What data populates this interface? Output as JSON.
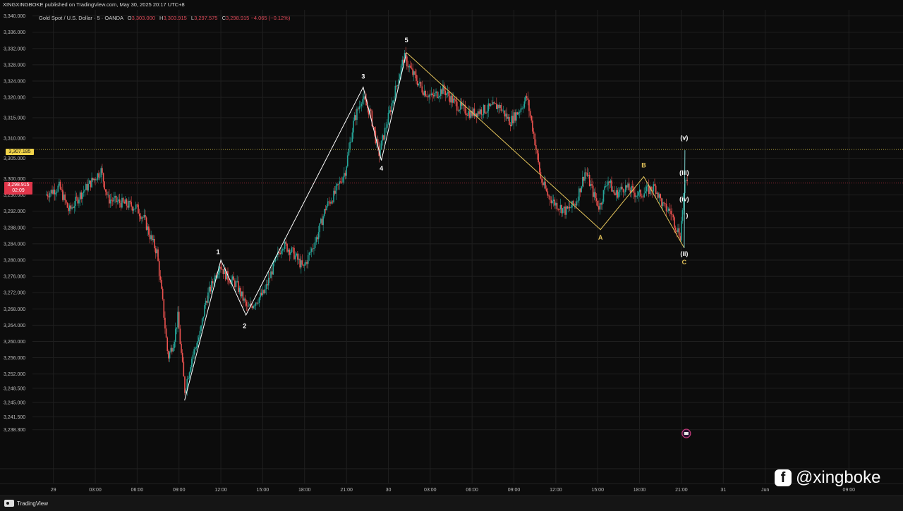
{
  "header": {
    "published_line": "XINGXINGBOKE published on TradingView.com, May 30, 2025 20:17 UTC+8",
    "symbol": "Gold Spot / U.S. Dollar · 5 · OANDA",
    "ohlc": {
      "o_label": "O",
      "o": "3,303.000",
      "h_label": "H",
      "h": "3,303.915",
      "l_label": "L",
      "l": "3,297.575",
      "c_label": "C",
      "c": "3,298.915",
      "change": "−4.065 (−0.12%)"
    }
  },
  "price_tags": {
    "horizontal_line": "3,307.185",
    "current_price": "3,298.915",
    "countdown": "02:09"
  },
  "footer": {
    "brand": "TradingView",
    "watermark": "@xingboke"
  },
  "colors": {
    "background": "#0c0c0c",
    "grid": "#1f1f1f",
    "candle_up": "#26a69a",
    "candle_down": "#ef5350",
    "impulse_line": "#ffffff",
    "correction_line": "#e2c25a",
    "horizontal_line": "#d4c24a",
    "current_price": "#e0364a"
  },
  "chart_data": {
    "type": "candlestick",
    "ylim": [
      3236.0,
      3341.5
    ],
    "y_ticks": [
      "3,340.000",
      "3,336.000",
      "3,332.000",
      "3,328.000",
      "3,324.000",
      "3,320.000",
      "3,315.000",
      "3,310.000",
      "3,305.000",
      "3,300.000",
      "3,296.000",
      "3,292.000",
      "3,288.000",
      "3,284.000",
      "3,280.000",
      "3,276.000",
      "3,272.000",
      "3,268.000",
      "3,264.000",
      "3,260.000",
      "3,256.000",
      "3,252.000",
      "3,248.500",
      "3,245.000",
      "3,241.500",
      "3,238.300"
    ],
    "y_tick_values": [
      3340,
      3336,
      3332,
      3328,
      3324,
      3320,
      3315,
      3310,
      3305,
      3300,
      3296,
      3292,
      3288,
      3284,
      3280,
      3276,
      3272,
      3268,
      3264,
      3260,
      3256,
      3252,
      3248.5,
      3245,
      3241.5,
      3238.3
    ],
    "x_ticks": [
      "29",
      "03:00",
      "06:00",
      "09:00",
      "12:00",
      "15:00",
      "18:00",
      "21:00",
      "30",
      "03:00",
      "06:00",
      "09:00",
      "12:00",
      "15:00",
      "18:00",
      "21:00",
      "31",
      "Jun",
      "09:00"
    ],
    "x_tick_hours": [
      0,
      3,
      6,
      9,
      12,
      15,
      18,
      21,
      24,
      27,
      30,
      33,
      36,
      39,
      42,
      45,
      48,
      51,
      57
    ],
    "x_range_hours": [
      -1.5,
      58.5
    ],
    "price_path": [
      [
        -0.5,
        3296
      ],
      [
        0.5,
        3298
      ],
      [
        1.2,
        3292
      ],
      [
        2,
        3296
      ],
      [
        3,
        3300
      ],
      [
        3.5,
        3302
      ],
      [
        4,
        3295
      ],
      [
        5,
        3294
      ],
      [
        6,
        3293
      ],
      [
        6.6,
        3290
      ],
      [
        7,
        3286
      ],
      [
        7.5,
        3282
      ],
      [
        7.9,
        3270
      ],
      [
        8.3,
        3256
      ],
      [
        8.7,
        3260
      ],
      [
        9,
        3266
      ],
      [
        9.3,
        3255
      ],
      [
        9.5,
        3248
      ],
      [
        10,
        3256
      ],
      [
        10.6,
        3262
      ],
      [
        11,
        3270
      ],
      [
        12,
        3279
      ],
      [
        12.5,
        3276
      ],
      [
        13.2,
        3274
      ],
      [
        14,
        3268
      ],
      [
        14.6,
        3270
      ],
      [
        15.2,
        3272
      ],
      [
        15.8,
        3278
      ],
      [
        16.5,
        3284
      ],
      [
        17.2,
        3282
      ],
      [
        18,
        3278
      ],
      [
        18.5,
        3282
      ],
      [
        19,
        3286
      ],
      [
        19.6,
        3293
      ],
      [
        20.2,
        3296
      ],
      [
        21,
        3302
      ],
      [
        21.6,
        3314
      ],
      [
        22.2,
        3320
      ],
      [
        22.8,
        3316
      ],
      [
        23.4,
        3306
      ],
      [
        24,
        3314
      ],
      [
        24.6,
        3322
      ],
      [
        25.2,
        3330
      ],
      [
        25.8,
        3326
      ],
      [
        26.5,
        3322
      ],
      [
        27.2,
        3320
      ],
      [
        28,
        3322
      ],
      [
        29,
        3318
      ],
      [
        30,
        3316
      ],
      [
        31,
        3317
      ],
      [
        32,
        3318
      ],
      [
        32.8,
        3314
      ],
      [
        33.5,
        3317
      ],
      [
        34,
        3320
      ],
      [
        34.5,
        3311
      ],
      [
        35,
        3300
      ],
      [
        35.5,
        3296
      ],
      [
        36,
        3294
      ],
      [
        36.8,
        3292
      ],
      [
        37.5,
        3294
      ],
      [
        38.2,
        3302
      ],
      [
        38.8,
        3296
      ],
      [
        39.2,
        3293
      ],
      [
        39.8,
        3300
      ],
      [
        40.3,
        3296
      ],
      [
        41,
        3298
      ],
      [
        42,
        3296
      ],
      [
        42.6,
        3297
      ],
      [
        43.2,
        3298
      ],
      [
        43.8,
        3293
      ],
      [
        44.3,
        3292
      ],
      [
        44.6,
        3289
      ],
      [
        45,
        3286
      ],
      [
        45.3,
        3298
      ],
      [
        45.5,
        3300
      ]
    ],
    "elliott_labels": [
      {
        "text": "1",
        "t": 11.8,
        "price": 3281.5,
        "color": "#ffffff"
      },
      {
        "text": "2",
        "t": 13.7,
        "price": 3263.3,
        "color": "#ffffff"
      },
      {
        "text": "3",
        "t": 22.2,
        "price": 3324.6,
        "color": "#ffffff"
      },
      {
        "text": "4",
        "t": 23.5,
        "price": 3302.0,
        "color": "#ffffff"
      },
      {
        "text": "5",
        "t": 25.3,
        "price": 3333.5,
        "color": "#ffffff"
      },
      {
        "text": "A",
        "t": 39.2,
        "price": 3285.0,
        "color": "#e2c25a"
      },
      {
        "text": "B",
        "t": 42.3,
        "price": 3302.8,
        "color": "#e2c25a"
      },
      {
        "text": "C",
        "t": 45.2,
        "price": 3279.0,
        "color": "#e2c25a"
      },
      {
        "text": "(v)",
        "t": 45.2,
        "price": 3309.5,
        "color": "#ffffff"
      },
      {
        "text": "(iii)",
        "t": 45.2,
        "price": 3301.0,
        "color": "#ffffff"
      },
      {
        "text": "(iv)",
        "t": 45.2,
        "price": 3294.5,
        "color": "#ffffff"
      },
      {
        "text": ")",
        "t": 45.4,
        "price": 3290.5,
        "color": "#ffffff"
      },
      {
        "text": "(ii)",
        "t": 45.2,
        "price": 3281.0,
        "color": "#ffffff"
      }
    ],
    "impulse_wave": [
      [
        9.4,
        3245.5
      ],
      [
        12,
        3280
      ],
      [
        13.8,
        3266.5
      ],
      [
        22.2,
        3322.5
      ],
      [
        23.5,
        3304.5
      ],
      [
        25.3,
        3331
      ]
    ],
    "correction_wave": [
      [
        25.3,
        3331
      ],
      [
        39.2,
        3287.5
      ],
      [
        42.3,
        3300.5
      ],
      [
        45.2,
        3283
      ]
    ],
    "sub_wave": [
      [
        45.2,
        3283
      ],
      [
        45.25,
        3307
      ]
    ],
    "horizontal_line": 3307.185,
    "current_price": 3298.915
  }
}
